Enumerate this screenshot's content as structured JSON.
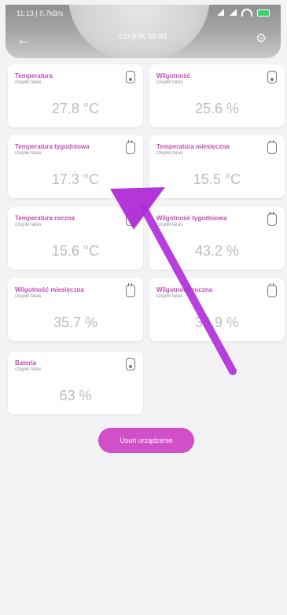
{
  "status_bar": {
    "time": "11:13 | 0,7kB/s"
  },
  "header": {
    "title": "czujnik taras",
    "back_icon": "back-arrow-icon",
    "settings_icon": "gear-icon"
  },
  "tiles": [
    {
      "name": "Temperatura",
      "device": "czujnik taras",
      "value": "27.8 °C",
      "icon": "thermometer-icon"
    },
    {
      "name": "Wilgotność",
      "device": "czujnik taras",
      "value": "25.6 %",
      "icon": "thermometer-icon"
    },
    {
      "name": "Temperatura tygodniowa",
      "device": "czujnik taras",
      "value": "17.3 °C",
      "icon": "plug-icon"
    },
    {
      "name": "Temperatura miesięczna",
      "device": "czujnik taras",
      "value": "15.5 °C",
      "icon": "plug-icon"
    },
    {
      "name": "Temperatura roczna",
      "device": "czujnik taras",
      "value": "15.6 °C",
      "icon": "plug-icon"
    },
    {
      "name": "Wilgotność tygodniowa",
      "device": "czujnik taras",
      "value": "43.2 %",
      "icon": "plug-icon"
    },
    {
      "name": "Wilgotność miesięczna",
      "device": "czujnik taras",
      "value": "35.7 %",
      "icon": "plug-icon"
    },
    {
      "name": "Wilgotność roczna",
      "device": "czujnik taras",
      "value": "36.9 %",
      "icon": "plug-icon"
    },
    {
      "name": "Bateria",
      "device": "czujnik taras",
      "value": "63 %",
      "icon": "thermometer-icon"
    }
  ],
  "actions": {
    "delete_label": "Usuń urządzenie"
  },
  "colors": {
    "accent": "#c24db3",
    "button": "#d14fc8",
    "annotation_arrow": "#b02bd9"
  }
}
